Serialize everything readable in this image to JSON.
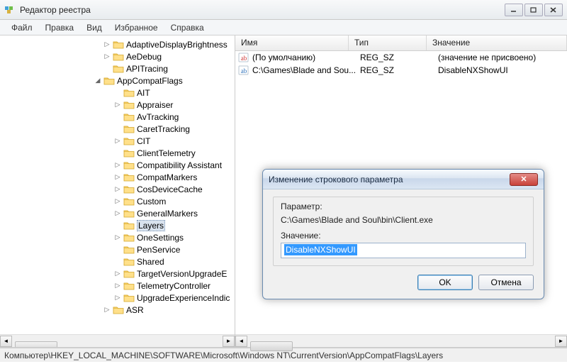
{
  "window": {
    "title": "Редактор реестра"
  },
  "menu": {
    "file": "Файл",
    "edit": "Правка",
    "view": "Вид",
    "favorites": "Избранное",
    "help": "Справка"
  },
  "tree": {
    "items": [
      {
        "label": "AdaptiveDisplayBrightness",
        "indent": 145,
        "expander": "▷"
      },
      {
        "label": "AeDebug",
        "indent": 145,
        "expander": "▷"
      },
      {
        "label": "APITracing",
        "indent": 145,
        "expander": ""
      },
      {
        "label": "AppCompatFlags",
        "indent": 132,
        "expander": "◢"
      },
      {
        "label": "AIT",
        "indent": 160,
        "expander": ""
      },
      {
        "label": "Appraiser",
        "indent": 160,
        "expander": "▷"
      },
      {
        "label": "AvTracking",
        "indent": 160,
        "expander": ""
      },
      {
        "label": "CaretTracking",
        "indent": 160,
        "expander": ""
      },
      {
        "label": "CIT",
        "indent": 160,
        "expander": "▷"
      },
      {
        "label": "ClientTelemetry",
        "indent": 160,
        "expander": ""
      },
      {
        "label": "Compatibility Assistant",
        "indent": 160,
        "expander": "▷"
      },
      {
        "label": "CompatMarkers",
        "indent": 160,
        "expander": "▷"
      },
      {
        "label": "CosDeviceCache",
        "indent": 160,
        "expander": "▷"
      },
      {
        "label": "Custom",
        "indent": 160,
        "expander": "▷"
      },
      {
        "label": "GeneralMarkers",
        "indent": 160,
        "expander": "▷"
      },
      {
        "label": "Layers",
        "indent": 160,
        "expander": "",
        "selected": true
      },
      {
        "label": "OneSettings",
        "indent": 160,
        "expander": "▷"
      },
      {
        "label": "PenService",
        "indent": 160,
        "expander": ""
      },
      {
        "label": "Shared",
        "indent": 160,
        "expander": ""
      },
      {
        "label": "TargetVersionUpgradeE",
        "indent": 160,
        "expander": "▷"
      },
      {
        "label": "TelemetryController",
        "indent": 160,
        "expander": "▷"
      },
      {
        "label": "UpgradeExperienceIndic",
        "indent": 160,
        "expander": "▷"
      },
      {
        "label": "ASR",
        "indent": 145,
        "expander": "▷"
      }
    ]
  },
  "list": {
    "columns": {
      "name": "Имя",
      "type": "Тип",
      "value": "Значение"
    },
    "rows": [
      {
        "icon_color": "#c33",
        "name": "(По умолчанию)",
        "type": "REG_SZ",
        "value": "(значение не присвоено)"
      },
      {
        "icon_color": "#2a6fbb",
        "name": "C:\\Games\\Blade and Sou...",
        "type": "REG_SZ",
        "value": "DisableNXShowUI"
      }
    ]
  },
  "dialog": {
    "title": "Изменение строкового параметра",
    "param_label": "Параметр:",
    "param_value": "C:\\Games\\Blade and Soul\\bin\\Client.exe",
    "value_label": "Значение:",
    "value_input": "DisableNXShowUI",
    "ok": "OK",
    "cancel": "Отмена"
  },
  "status": {
    "path": "Компьютер\\HKEY_LOCAL_MACHINE\\SOFTWARE\\Microsoft\\Windows NT\\CurrentVersion\\AppCompatFlags\\Layers"
  }
}
